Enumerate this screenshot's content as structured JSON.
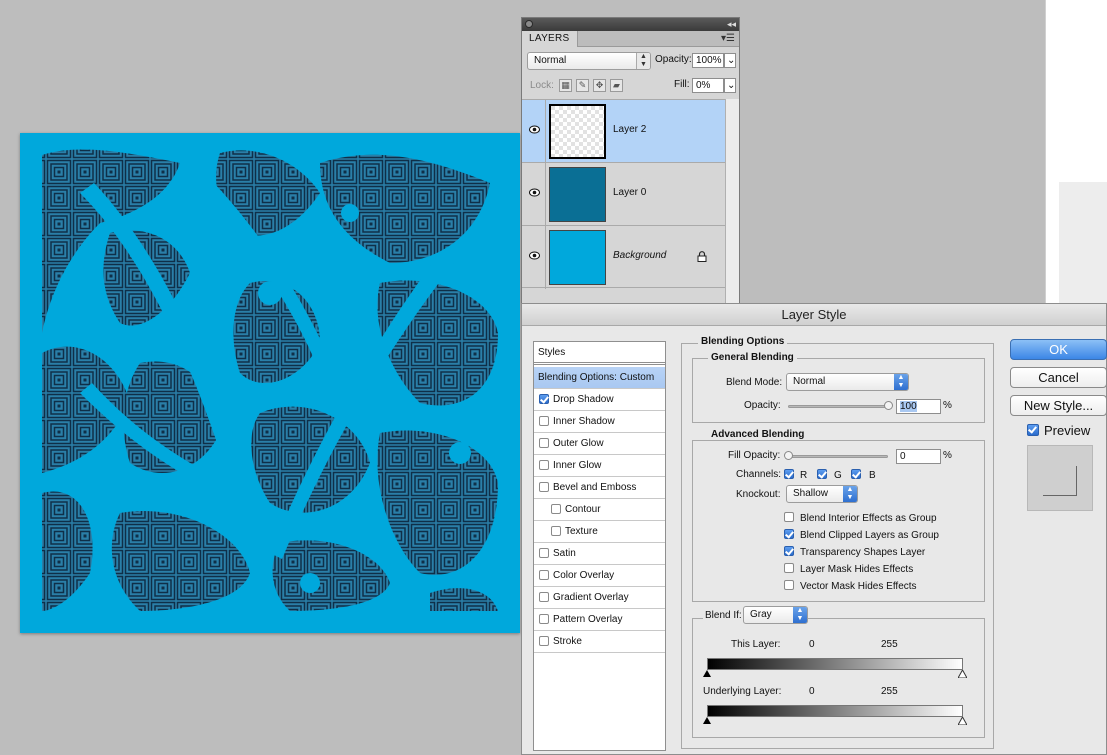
{
  "layers_panel": {
    "tab_label": "LAYERS",
    "blend_mode": "Normal",
    "opacity_label": "Opacity:",
    "opacity_value": "100%",
    "lock_label": "Lock:",
    "fill_label": "Fill:",
    "fill_value": "0%",
    "layers": [
      {
        "name": "Layer 2",
        "selected": true
      },
      {
        "name": "Layer 0",
        "selected": false
      },
      {
        "name": "Background",
        "selected": false,
        "locked": true
      }
    ]
  },
  "canvas": {
    "background_color": "#00a8dc",
    "pattern_color": "#0f2f48"
  },
  "dialog": {
    "title": "Layer Style",
    "styles_header": "Styles",
    "styles": [
      {
        "label": "Blending Options: Custom",
        "selected": true
      },
      {
        "label": "Drop Shadow",
        "checked": true
      },
      {
        "label": "Inner Shadow",
        "checked": false
      },
      {
        "label": "Outer Glow",
        "checked": false
      },
      {
        "label": "Inner Glow",
        "checked": false
      },
      {
        "label": "Bevel and Emboss",
        "checked": false
      },
      {
        "label": "Contour",
        "checked": false,
        "sub": true
      },
      {
        "label": "Texture",
        "checked": false,
        "sub": true
      },
      {
        "label": "Satin",
        "checked": false
      },
      {
        "label": "Color Overlay",
        "checked": false
      },
      {
        "label": "Gradient Overlay",
        "checked": false
      },
      {
        "label": "Pattern Overlay",
        "checked": false
      },
      {
        "label": "Stroke",
        "checked": false
      }
    ],
    "blending_options_title": "Blending Options",
    "general_blending": {
      "title": "General Blending",
      "blend_mode_label": "Blend Mode:",
      "blend_mode_value": "Normal",
      "opacity_label": "Opacity:",
      "opacity_value": "100",
      "percent": "%"
    },
    "advanced_blending": {
      "title": "Advanced Blending",
      "fill_opacity_label": "Fill Opacity:",
      "fill_opacity_value": "0",
      "percent": "%",
      "channels_label": "Channels:",
      "channel_r": "R",
      "channel_g": "G",
      "channel_b": "B",
      "knockout_label": "Knockout:",
      "knockout_value": "Shallow",
      "options": [
        {
          "label": "Blend Interior Effects as Group",
          "checked": false
        },
        {
          "label": "Blend Clipped Layers as Group",
          "checked": true
        },
        {
          "label": "Transparency Shapes Layer",
          "checked": true
        },
        {
          "label": "Layer Mask Hides Effects",
          "checked": false
        },
        {
          "label": "Vector Mask Hides Effects",
          "checked": false
        }
      ]
    },
    "blend_if": {
      "label": "Blend If:",
      "value": "Gray",
      "this_layer_label": "This Layer:",
      "this_layer_min": "0",
      "this_layer_max": "255",
      "underlying_label": "Underlying Layer:",
      "underlying_min": "0",
      "underlying_max": "255"
    },
    "buttons": {
      "ok": "OK",
      "cancel": "Cancel",
      "new_style": "New Style..."
    },
    "preview_label": "Preview",
    "preview_checked": true
  }
}
